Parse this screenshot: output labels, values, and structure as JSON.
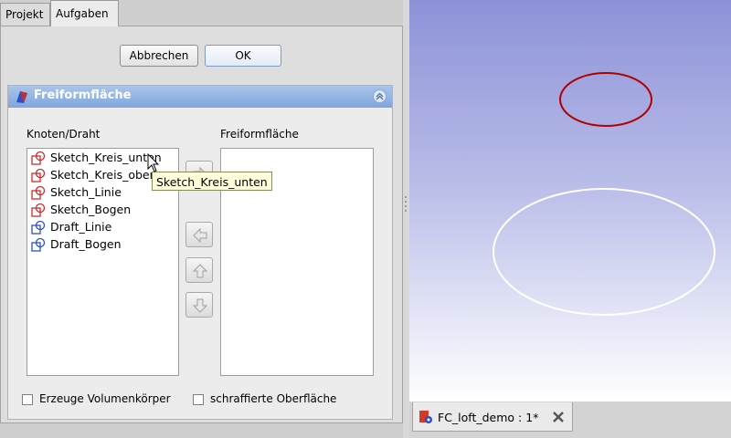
{
  "combo_tabs": [
    {
      "label": "Projekt",
      "active": false
    },
    {
      "label": "Aufgaben",
      "active": true
    }
  ],
  "buttons": {
    "cancel": "Abbrechen",
    "ok": "OK"
  },
  "section": {
    "title": "Freiformfläche",
    "left_list_label": "Knoten/Draht",
    "right_list_label": "Freiformfläche",
    "items": [
      {
        "label": "Sketch_Kreis_unten",
        "icon": "sketch-icon",
        "color": "#d12a2a"
      },
      {
        "label": "Sketch_Kreis_oben",
        "icon": "sketch-icon",
        "color": "#d12a2a"
      },
      {
        "label": "Sketch_Linie",
        "icon": "sketch-icon",
        "color": "#d12a2a"
      },
      {
        "label": "Sketch_Bogen",
        "icon": "sketch-icon",
        "color": "#d12a2a"
      },
      {
        "label": "Draft_Linie",
        "icon": "draft-icon",
        "color": "#2a4fd1"
      },
      {
        "label": "Draft_Bogen",
        "icon": "draft-icon",
        "color": "#2a4fd1"
      }
    ],
    "arrow_buttons": [
      "arrow-right-icon",
      "arrow-left-icon",
      "arrow-up-icon",
      "arrow-down-icon"
    ],
    "checkbox_solid": {
      "label": "Erzeuge Volumenkörper",
      "checked": false
    },
    "checkbox_ruled": {
      "label": "schraffierte Oberfläche",
      "checked": false
    }
  },
  "tooltip": "Sketch_Kreis_unten",
  "document_tab": {
    "label": "FC_loft_demo : 1*"
  },
  "colors": {
    "header_blue": "#7fa6dd",
    "selected_curve": "#b00000",
    "unselected_curve": "#ffffff"
  }
}
